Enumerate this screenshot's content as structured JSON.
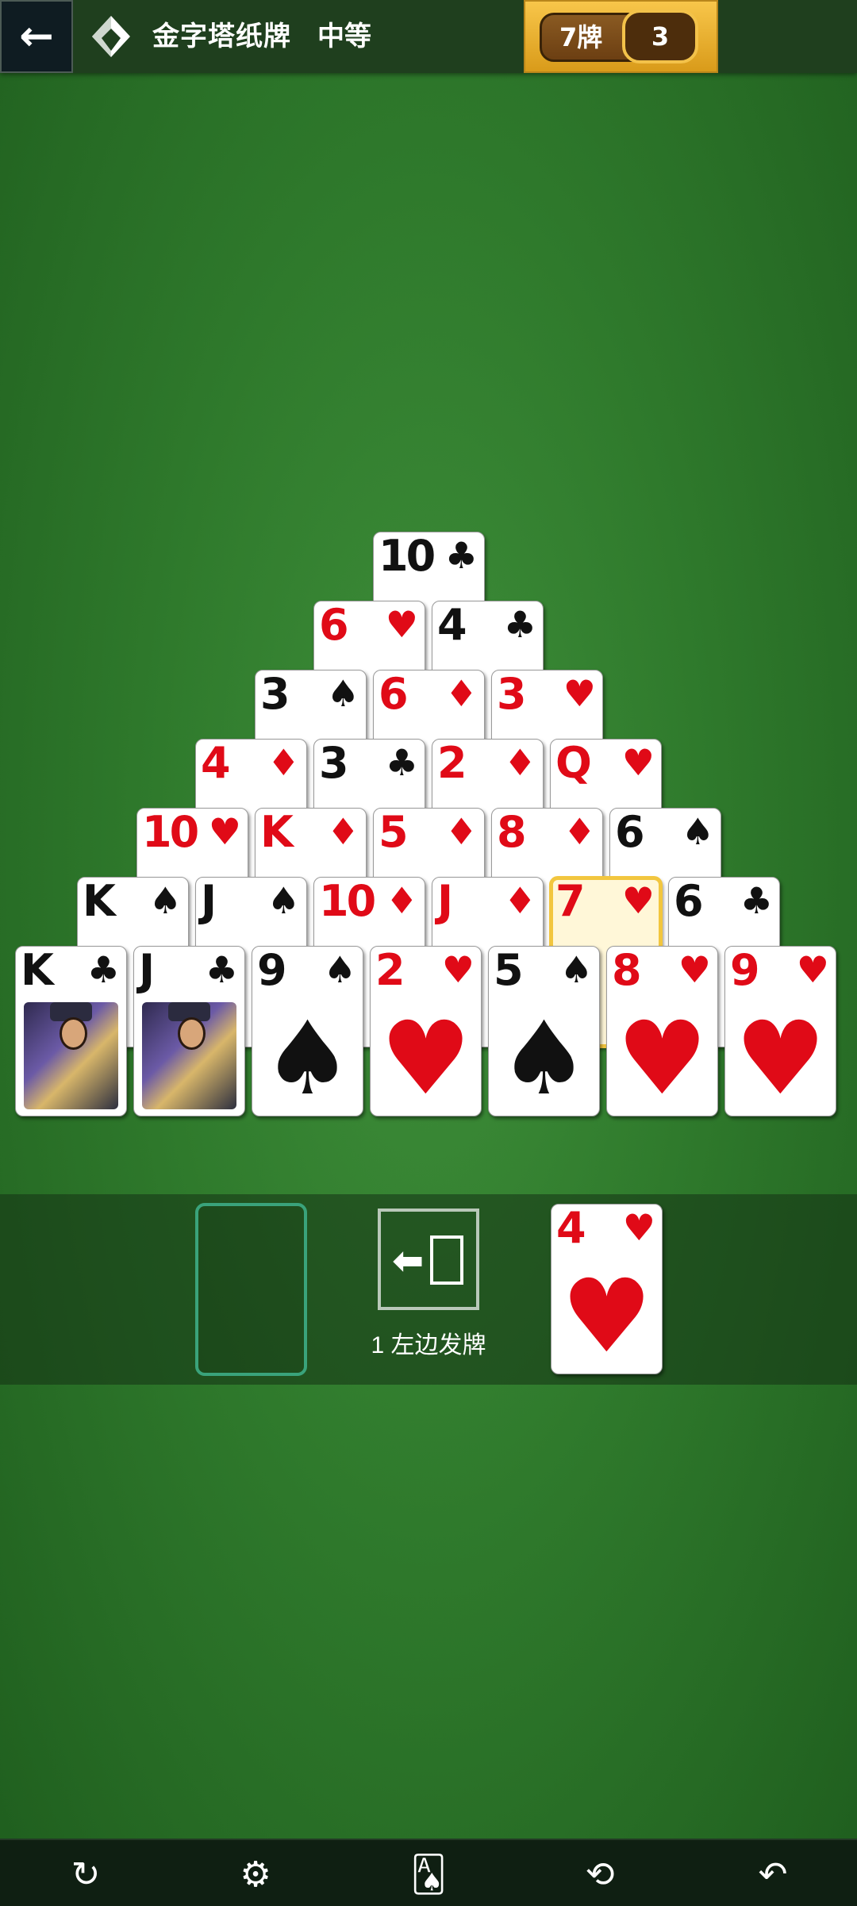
{
  "header": {
    "back_icon": "←",
    "title": "金字塔纸牌",
    "difficulty": "中等",
    "deck_label": "7牌",
    "deck_count": "3"
  },
  "pyramid": [
    {
      "rank": "10",
      "suit": "♣",
      "color": "black"
    },
    {
      "rank": "6",
      "suit": "♥",
      "color": "red"
    },
    {
      "rank": "4",
      "suit": "♣",
      "color": "black"
    },
    {
      "rank": "3",
      "suit": "♠",
      "color": "black"
    },
    {
      "rank": "6",
      "suit": "♦",
      "color": "red"
    },
    {
      "rank": "3",
      "suit": "♥",
      "color": "red"
    },
    {
      "rank": "4",
      "suit": "♦",
      "color": "red"
    },
    {
      "rank": "3",
      "suit": "♣",
      "color": "black"
    },
    {
      "rank": "2",
      "suit": "♦",
      "color": "red"
    },
    {
      "rank": "Q",
      "suit": "♥",
      "color": "red"
    },
    {
      "rank": "10",
      "suit": "♥",
      "color": "red"
    },
    {
      "rank": "K",
      "suit": "♦",
      "color": "red"
    },
    {
      "rank": "5",
      "suit": "♦",
      "color": "red"
    },
    {
      "rank": "8",
      "suit": "♦",
      "color": "red"
    },
    {
      "rank": "6",
      "suit": "♠",
      "color": "black"
    },
    {
      "rank": "K",
      "suit": "♠",
      "color": "black"
    },
    {
      "rank": "J",
      "suit": "♠",
      "color": "black"
    },
    {
      "rank": "10",
      "suit": "♦",
      "color": "red"
    },
    {
      "rank": "J",
      "suit": "♦",
      "color": "red"
    },
    {
      "rank": "7",
      "suit": "♥",
      "color": "red",
      "selected": true
    },
    {
      "rank": "6",
      "suit": "♣",
      "color": "black"
    },
    {
      "rank": "K",
      "suit": "♣",
      "color": "black",
      "face": true
    },
    {
      "rank": "J",
      "suit": "♣",
      "color": "black",
      "face": true
    },
    {
      "rank": "9",
      "suit": "♠",
      "color": "black"
    },
    {
      "rank": "2",
      "suit": "♥",
      "color": "red"
    },
    {
      "rank": "5",
      "suit": "♠",
      "color": "black"
    },
    {
      "rank": "8",
      "suit": "♥",
      "color": "red"
    },
    {
      "rank": "9",
      "suit": "♥",
      "color": "red"
    }
  ],
  "waste_card": {
    "rank": "4",
    "suit": "♥",
    "color": "red"
  },
  "deal": {
    "label": "1 左边发牌"
  },
  "toolbar": {
    "restart_icon": "↻",
    "settings_icon": "⚙",
    "cards_icon": "🂡",
    "hint_icon": "⟲",
    "undo_icon": "↶"
  }
}
